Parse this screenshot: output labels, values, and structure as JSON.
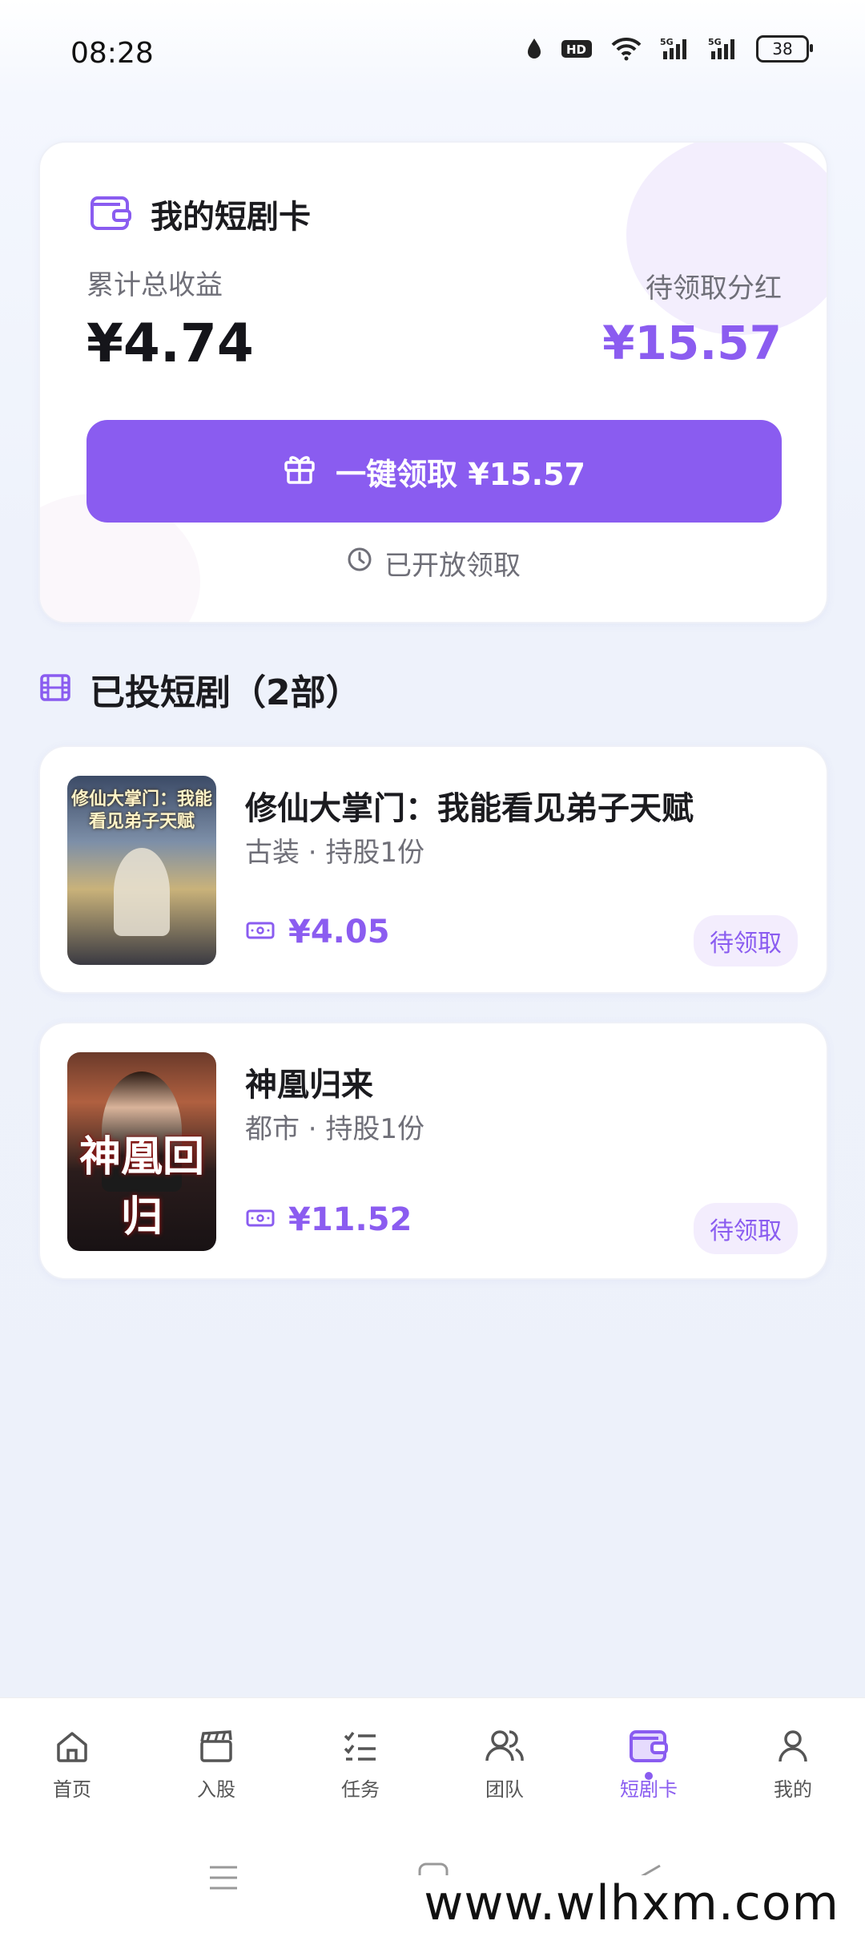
{
  "status_bar": {
    "time": "08:28",
    "hd_label": "HD",
    "network_1": "5G",
    "network_2": "5G",
    "battery": "38"
  },
  "summary": {
    "title": "我的短剧卡",
    "total_label": "累计总收益",
    "total_value": "¥4.74",
    "pending_label": "待领取分红",
    "pending_value": "¥15.57",
    "claim_button": "一键领取 ¥15.57",
    "open_status": "已开放领取"
  },
  "section": {
    "title": "已投短剧（2部）"
  },
  "dramas": [
    {
      "title": "修仙大掌门：我能看见弟子天赋",
      "meta": "古装 · 持股1份",
      "earning": "¥4.05",
      "status": "待领取",
      "poster_text": "修仙大掌门：我能看见弟子天赋"
    },
    {
      "title": "神凰归来",
      "meta": "都市 · 持股1份",
      "earning": "¥11.52",
      "status": "待领取",
      "poster_text": "神凰回归"
    }
  ],
  "bottom_nav": [
    {
      "label": "首页",
      "icon": "home-icon"
    },
    {
      "label": "入股",
      "icon": "clapperboard-icon"
    },
    {
      "label": "任务",
      "icon": "checklist-icon"
    },
    {
      "label": "团队",
      "icon": "team-icon"
    },
    {
      "label": "短剧卡",
      "icon": "wallet-icon",
      "active": true
    },
    {
      "label": "我的",
      "icon": "person-icon"
    }
  ],
  "watermark": "www.wlhxm.com",
  "colors": {
    "accent": "#8a5cf0",
    "text": "#1b1b1f",
    "muted": "#6f6f78",
    "badge_bg": "#f3edfd"
  }
}
